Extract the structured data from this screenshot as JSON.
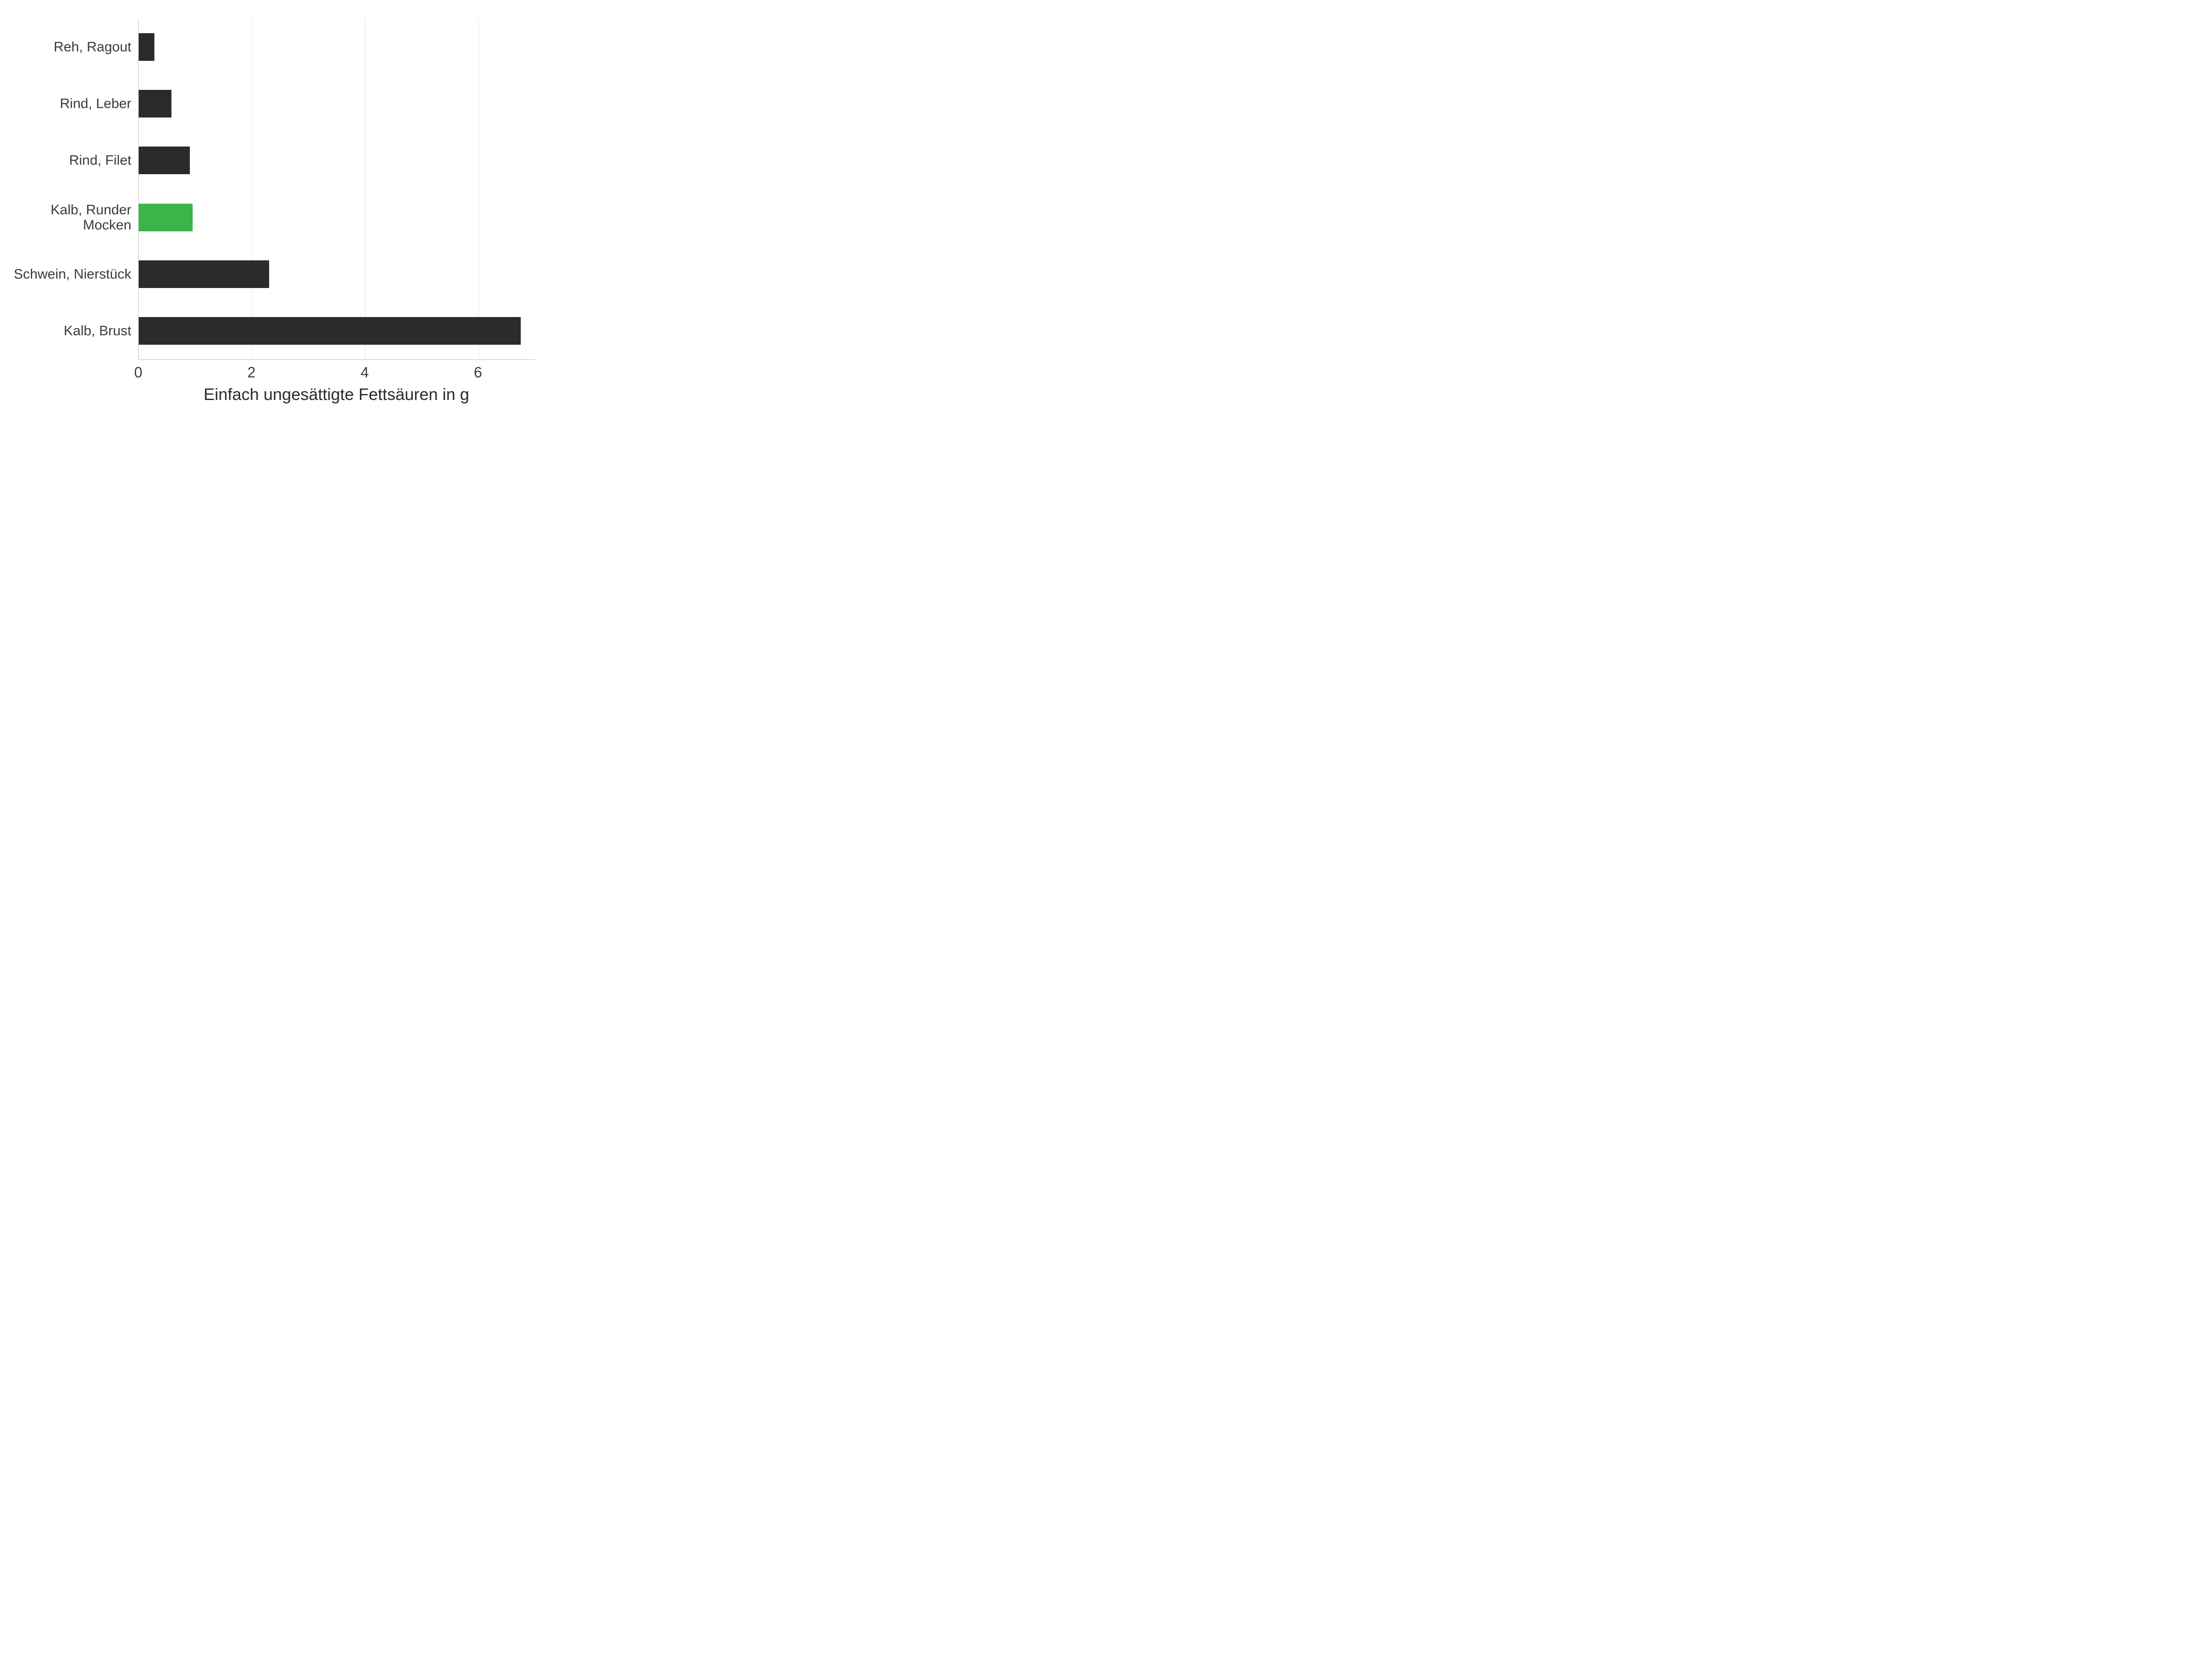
{
  "chart_data": {
    "type": "bar",
    "orientation": "horizontal",
    "categories": [
      "Reh, Ragout",
      "Rind, Leber",
      "Rind, Filet",
      "Kalb, Runder Mocken",
      "Schwein, Nierstück",
      "Kalb, Brust"
    ],
    "values": [
      0.28,
      0.58,
      0.9,
      0.95,
      2.3,
      6.75
    ],
    "highlight_index": 3,
    "xlabel": "Einfach ungesättigte Fettsäuren in g",
    "ylabel": "",
    "xlim": [
      0,
      7
    ],
    "x_ticks": [
      0,
      2,
      4,
      6
    ],
    "colors": {
      "default": "#2b2b2b",
      "highlight": "#3bb54a",
      "grid": "#e5e5e5",
      "axis": "#bdbdbd"
    }
  }
}
